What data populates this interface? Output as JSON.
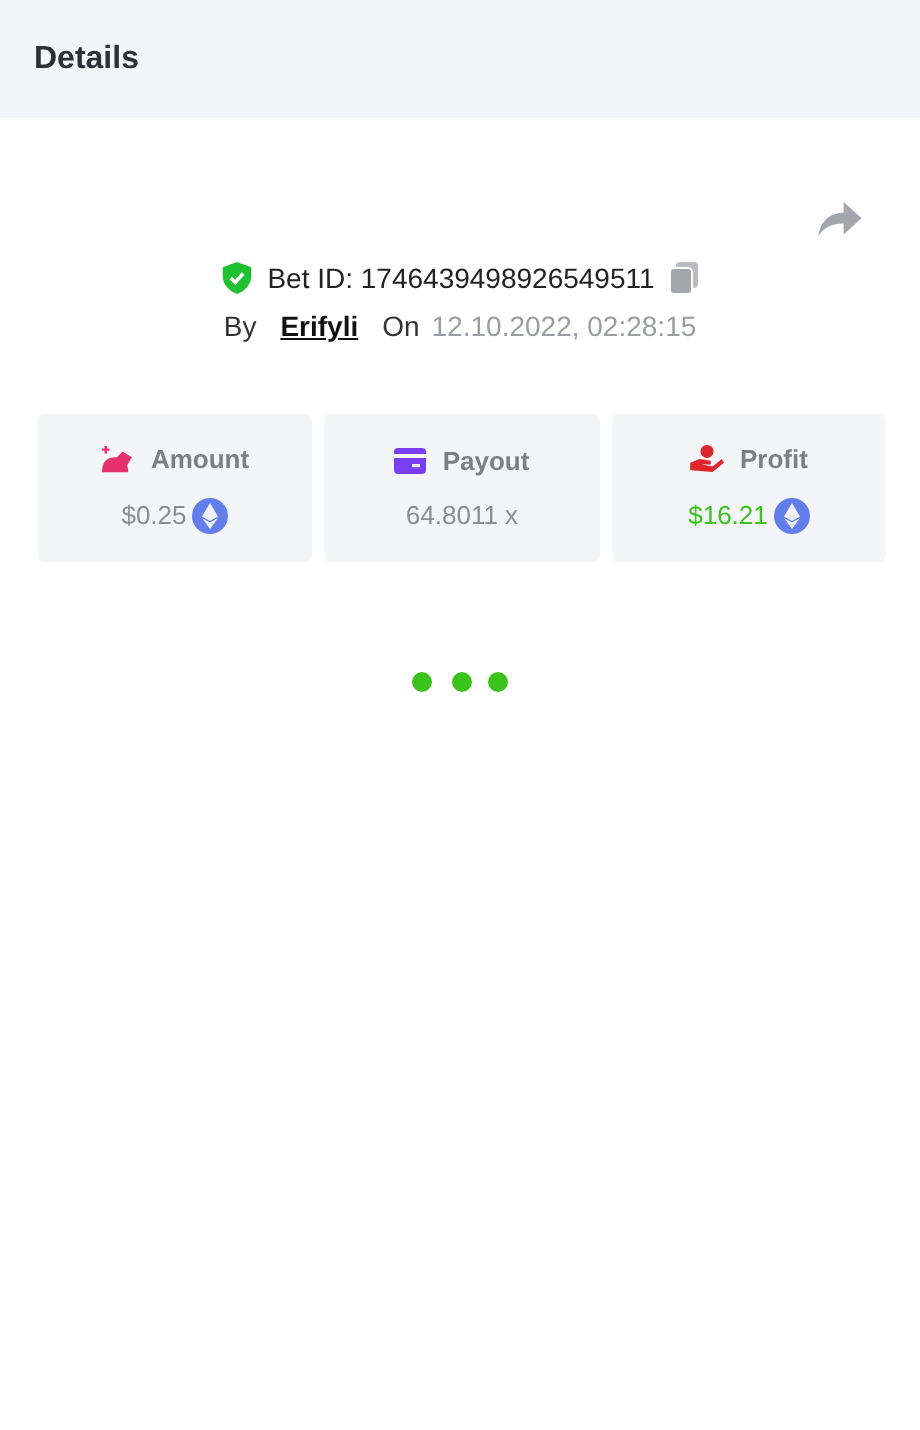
{
  "header": {
    "title": "Details"
  },
  "bet": {
    "verified": true,
    "label": "Bet ID:",
    "id": "1746439498926549511",
    "by_label": "By",
    "user": "Erifyli",
    "on_label": "On",
    "date": "12.10.2022, 02:28:15"
  },
  "stats": [
    {
      "kind": "amount",
      "label": "Amount",
      "value": "$0.25",
      "coin": true,
      "positive": false
    },
    {
      "kind": "payout",
      "label": "Payout",
      "value": "64.8011 x",
      "coin": false,
      "positive": false
    },
    {
      "kind": "profit",
      "label": "Profit",
      "value": "$16.21",
      "coin": true,
      "positive": true
    }
  ],
  "loading": true
}
